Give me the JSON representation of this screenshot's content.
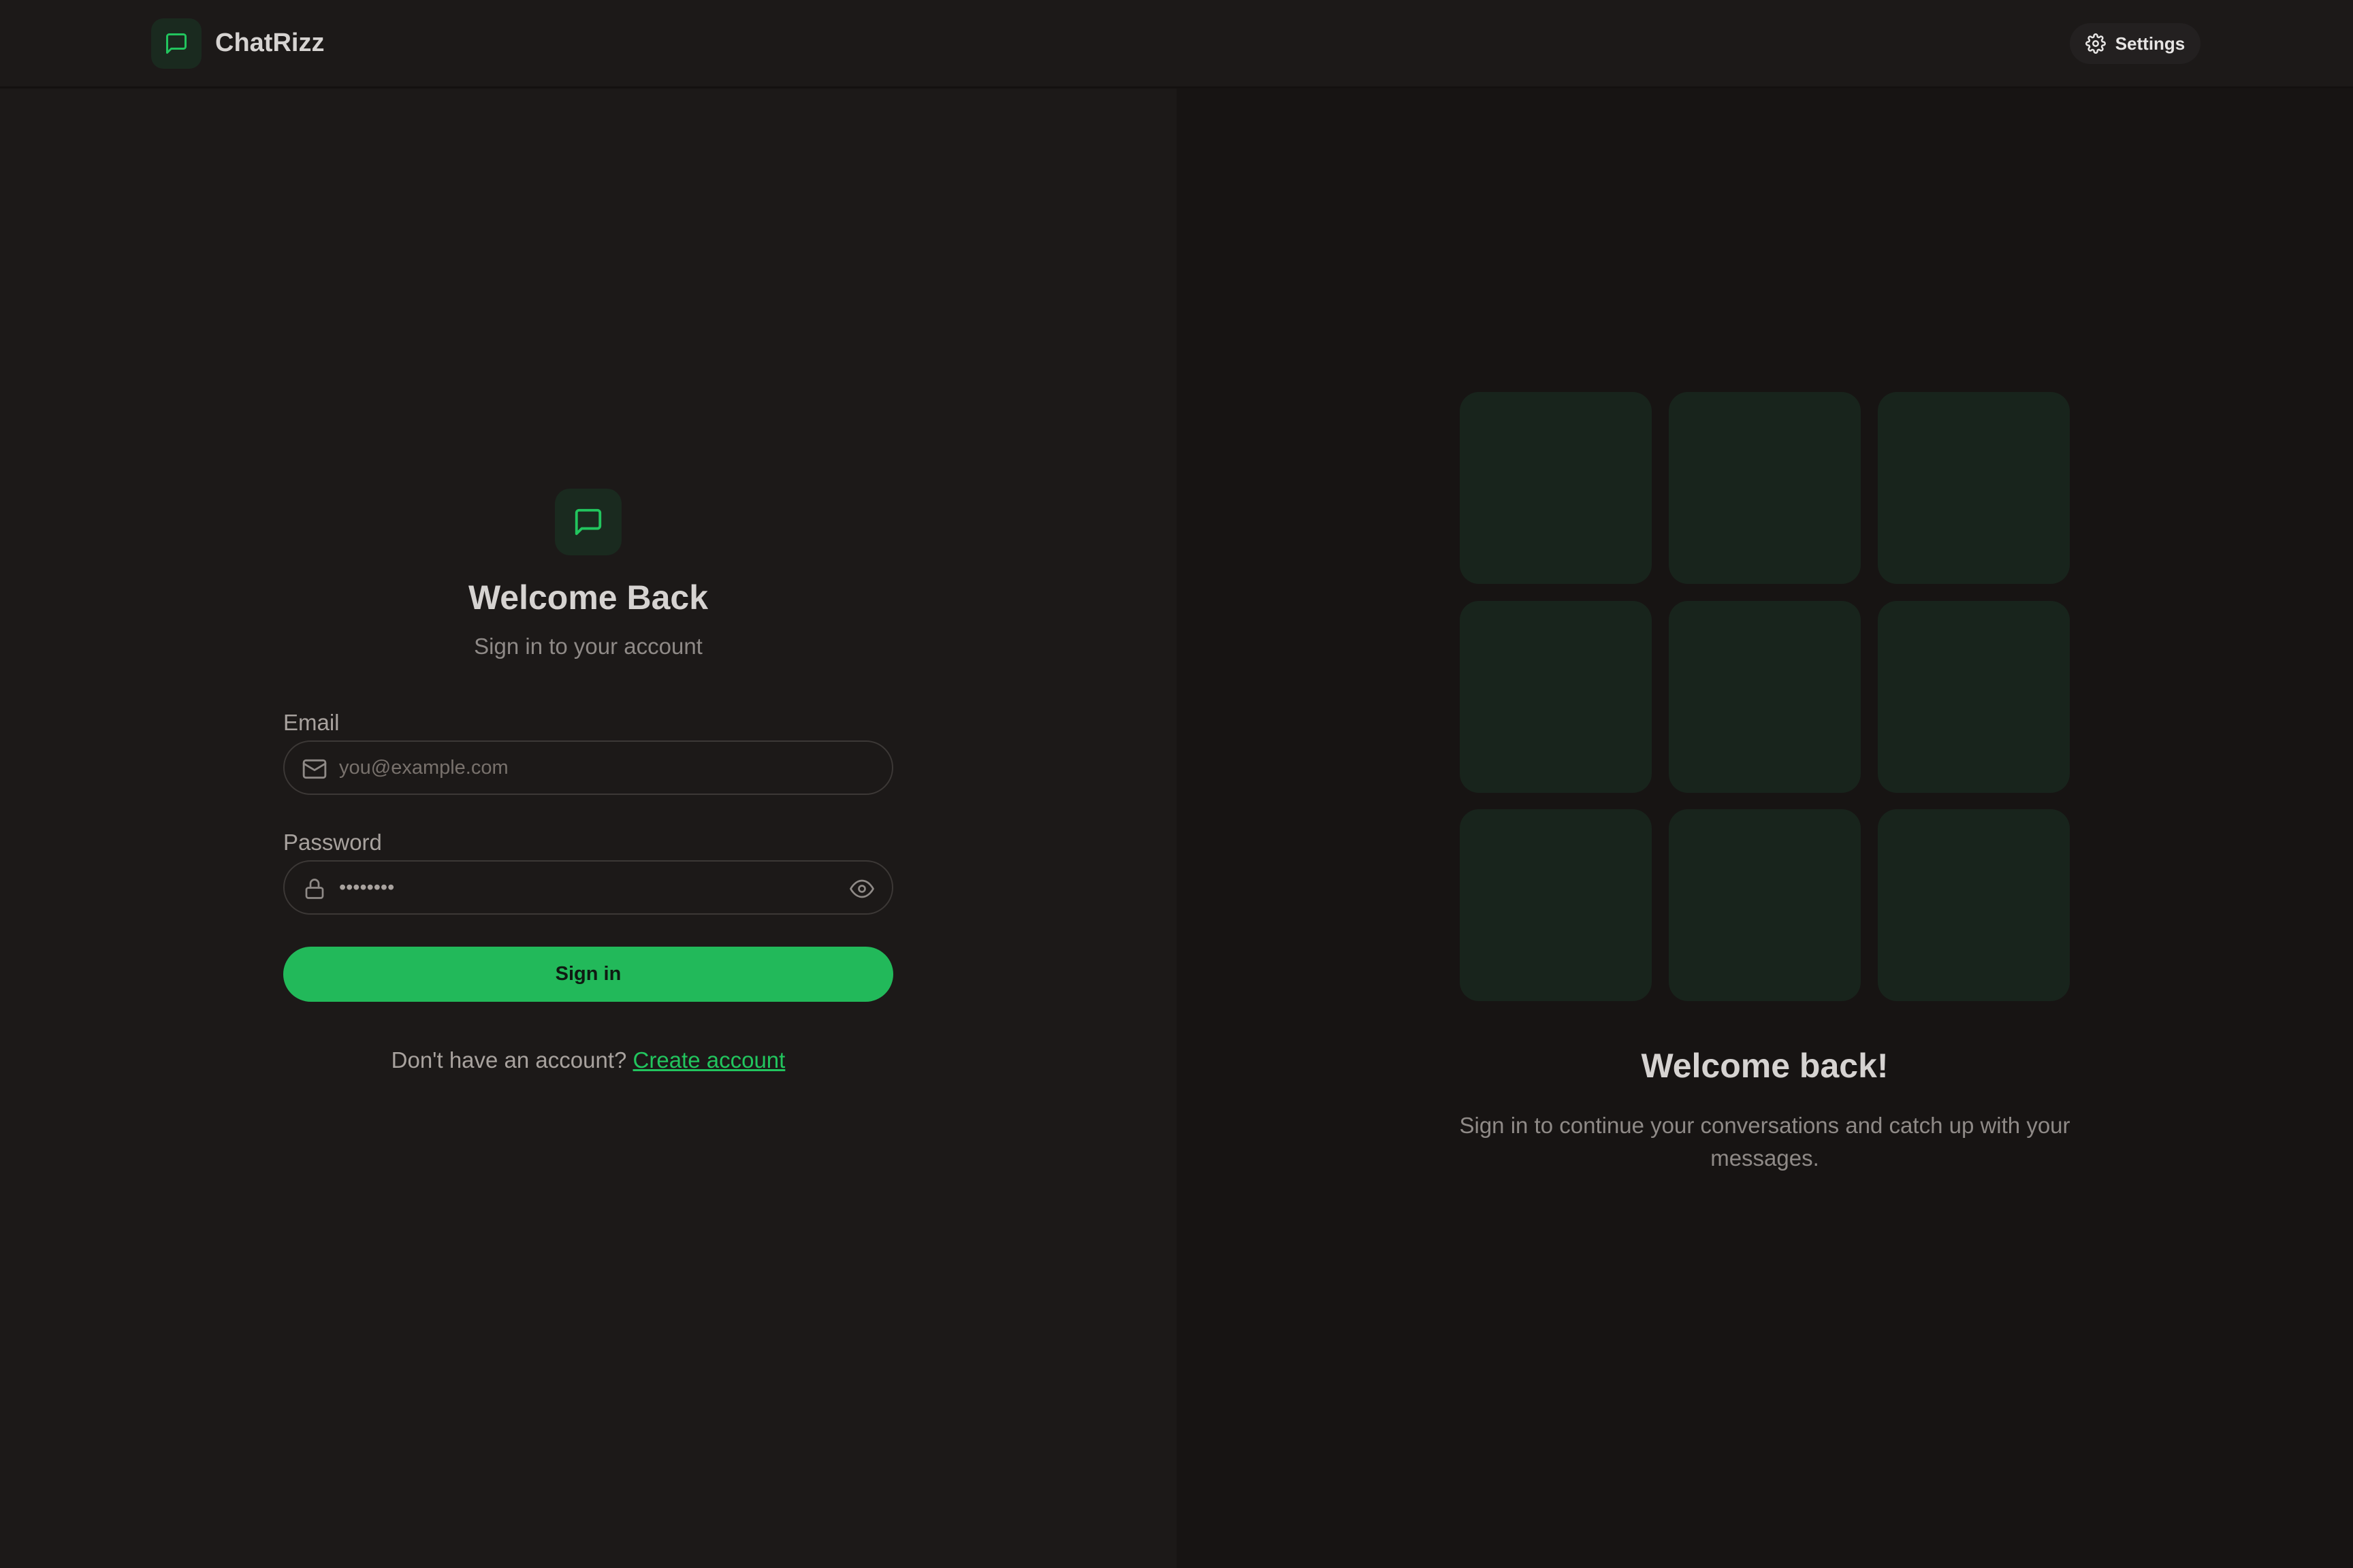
{
  "header": {
    "brand_name": "ChatRizz",
    "settings_label": "Settings"
  },
  "login": {
    "title": "Welcome Back",
    "subtitle": "Sign in to your account",
    "email_label": "Email",
    "email_placeholder": "you@example.com",
    "password_label": "Password",
    "password_value": "••••••••",
    "signin_label": "Sign in",
    "signup_prompt": "Don't have an account?",
    "signup_link": "Create account"
  },
  "hero": {
    "title": "Welcome back!",
    "subtitle": "Sign in to continue your conversations and catch up with your messages."
  },
  "icons": {
    "brand": "message-square-icon",
    "settings": "gear-icon",
    "email": "mail-icon",
    "password": "lock-icon",
    "toggle": "eye-icon"
  },
  "colors": {
    "accent": "#22c55e",
    "background": "#1c1918",
    "panel_right": "#171413",
    "tile": "#18241c"
  }
}
